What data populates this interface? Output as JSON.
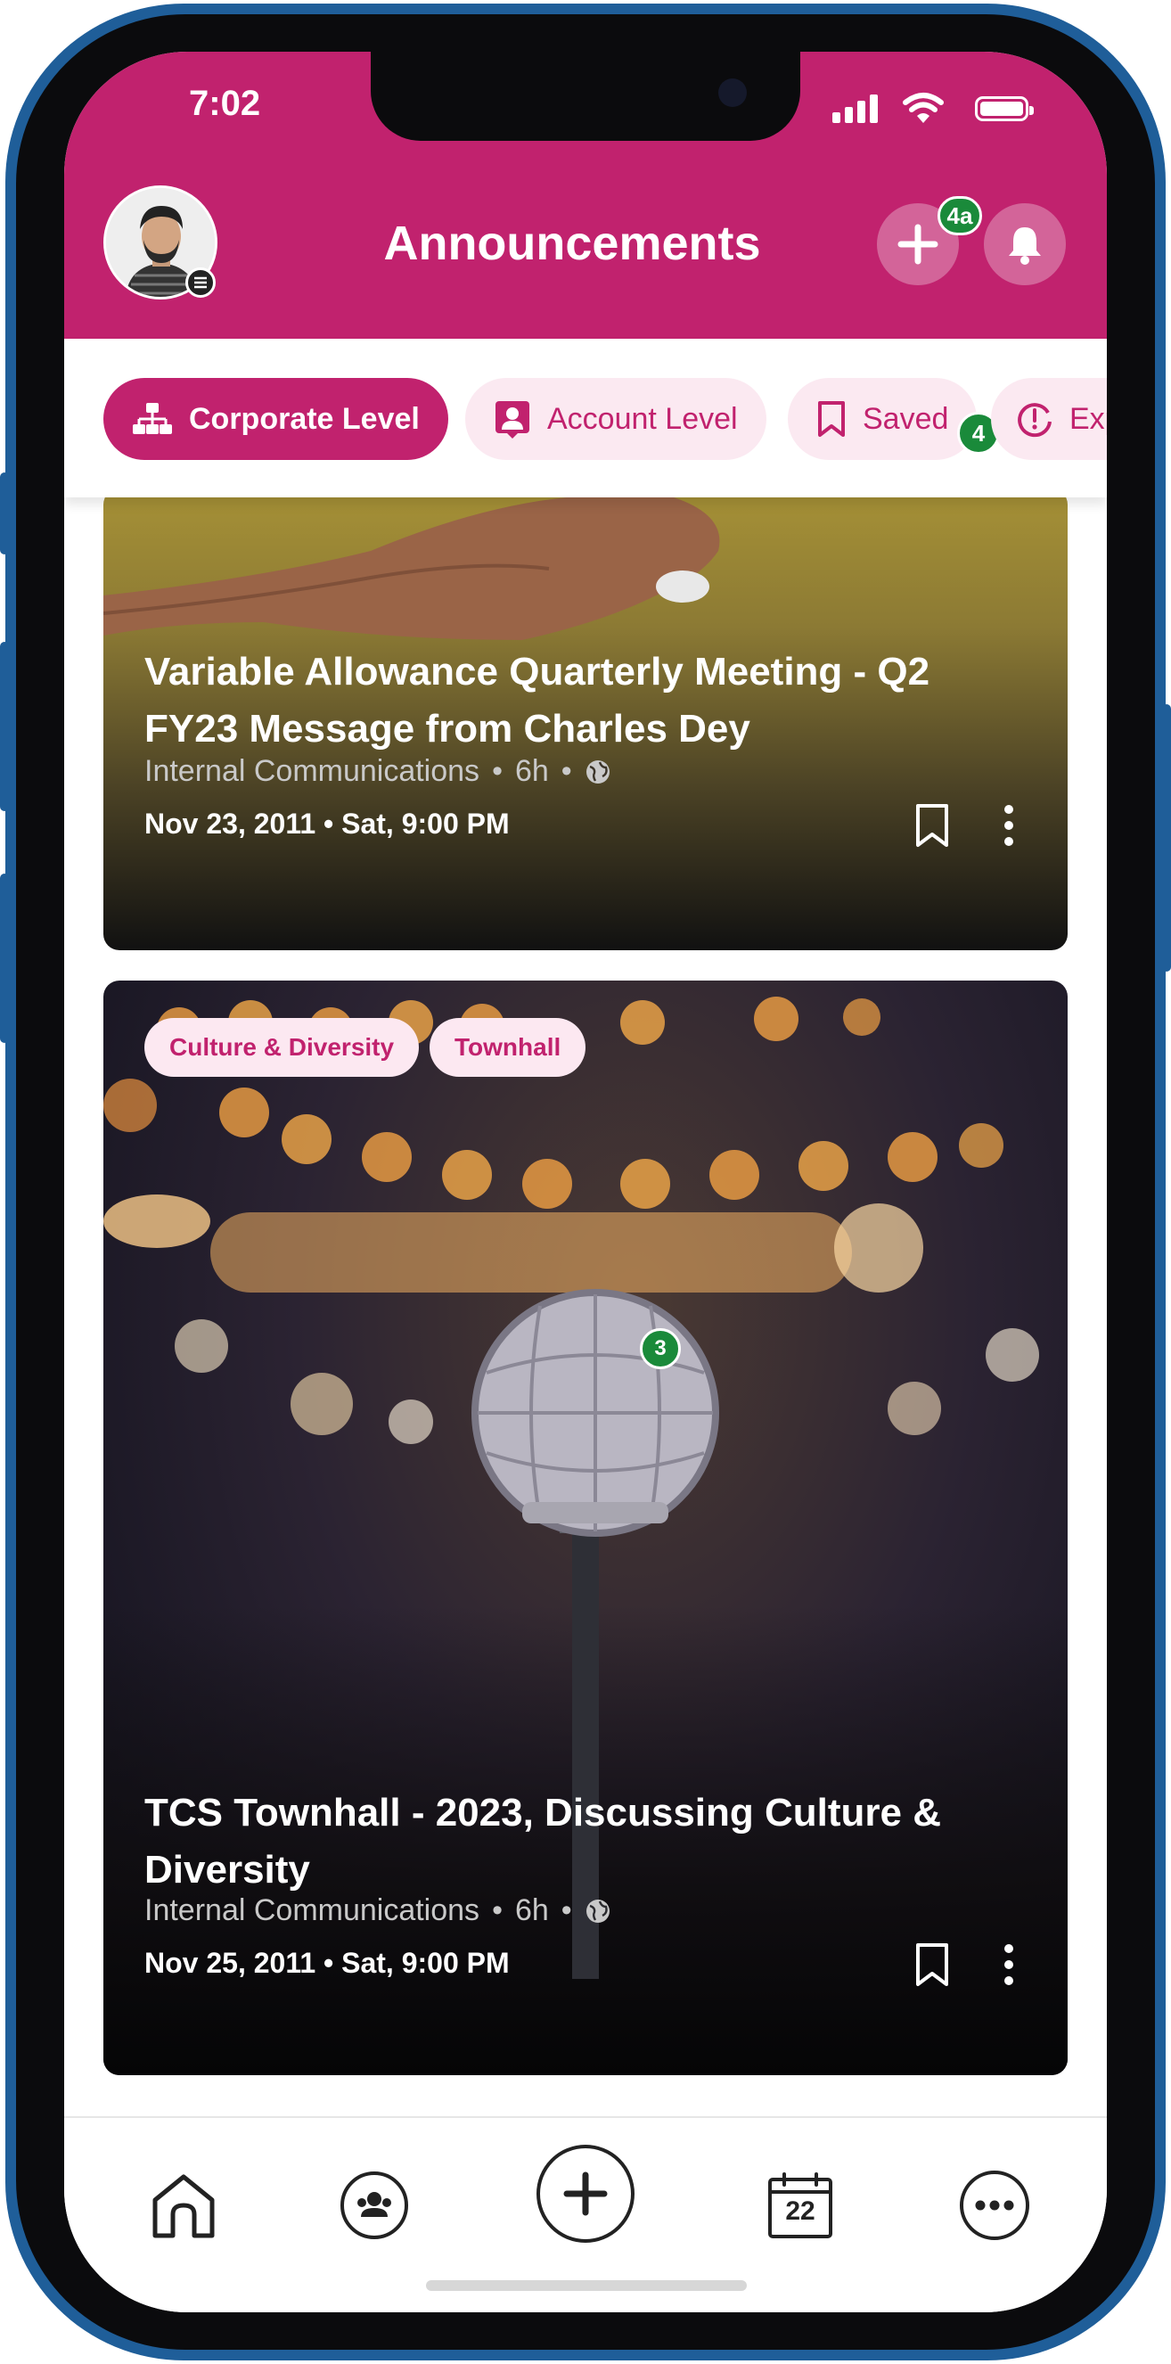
{
  "status_bar": {
    "time": "7:02"
  },
  "header": {
    "title": "Announcements",
    "create_badge": "4a"
  },
  "tabs": [
    {
      "label": "Corporate Level",
      "icon": "org-chart-icon",
      "active": true
    },
    {
      "label": "Account Level",
      "icon": "account-card-icon",
      "active": false
    },
    {
      "label": "Saved",
      "icon": "bookmark-icon",
      "active": false,
      "badge": "4"
    },
    {
      "label": "Exp",
      "icon": "expiring-clock-icon",
      "active": false
    }
  ],
  "posts": [
    {
      "title": "Variable Allowance Quarterly Meeting - Q2 FY23 Message from Charles Dey",
      "author": "Internal Communications",
      "age": "6h",
      "date": "Nov 23, 2011 • Sat, 9:00 PM"
    },
    {
      "tags": [
        "Culture & Diversity",
        "Townhall"
      ],
      "image_badge": "3",
      "title": "TCS Townhall - 2023, Discussing Culture & Diversity",
      "author": "Internal Communications",
      "age": "6h",
      "date": "Nov 25, 2011 • Sat, 9:00 PM"
    }
  ],
  "bottom_nav": {
    "items": [
      "home-icon",
      "community-icon",
      "create-icon",
      "calendar-icon",
      "more-icon"
    ],
    "calendar_day": "22"
  },
  "colors": {
    "brand": "#c1226e",
    "badge": "#1a8a3a",
    "frame": "#1f5e99"
  }
}
